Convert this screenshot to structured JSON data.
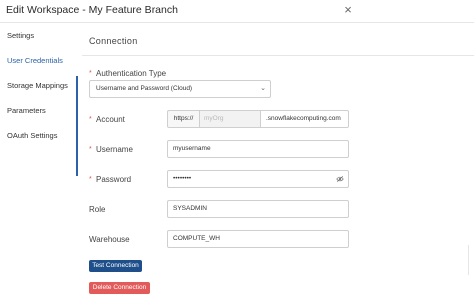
{
  "window": {
    "title": "Edit Workspace - My Feature Branch",
    "close_icon": "×"
  },
  "sidebar": {
    "items": [
      {
        "label": "Settings",
        "active": false
      },
      {
        "label": "User Credentials",
        "active": true
      },
      {
        "label": "Storage Mappings",
        "active": false
      },
      {
        "label": "Parameters",
        "active": false
      },
      {
        "label": "OAuth Settings",
        "active": false
      }
    ]
  },
  "section": {
    "title": "Connection"
  },
  "form": {
    "required_marker": "*",
    "auth_type": {
      "label": "Authentication Type",
      "value": "Username and Password (Cloud)",
      "chevron": "⌄"
    },
    "account": {
      "label": "Account",
      "prefix": "https://",
      "placeholder": "myOrg",
      "suffix": ".snowflakecomputing.com"
    },
    "username": {
      "label": "Username",
      "value": "myusername"
    },
    "password": {
      "label": "Password",
      "value": "••••••••"
    },
    "role": {
      "label": "Role",
      "value": "SYSADMIN"
    },
    "warehouse": {
      "label": "Warehouse",
      "value": "COMPUTE_WH"
    }
  },
  "buttons": {
    "test": "Test Connection",
    "delete": "Delete Connection"
  },
  "colors": {
    "accent": "#2d63a6",
    "primary_button": "#1f4f8a",
    "danger_button": "#e25a5a",
    "required": "#d9534f"
  }
}
